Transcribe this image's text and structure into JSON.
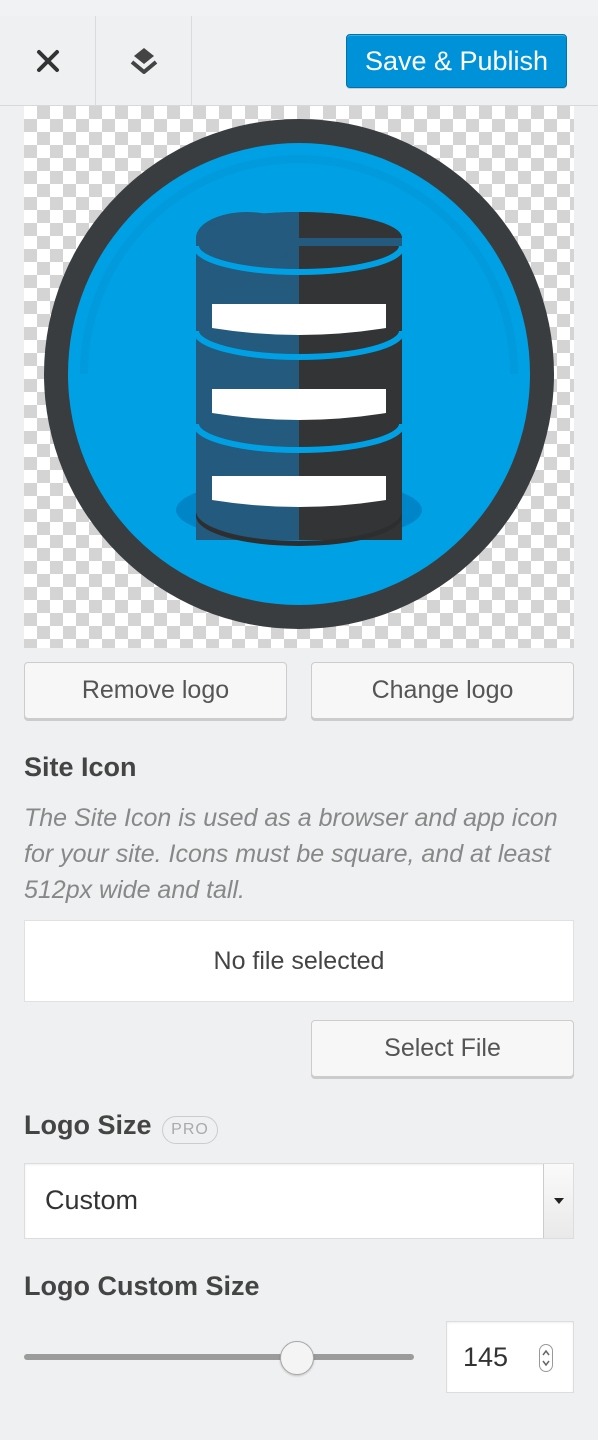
{
  "header": {
    "close_icon": "close-icon",
    "collapse_icon": "collapse-icon",
    "publish_label": "Save & Publish"
  },
  "logo": {
    "remove_label": "Remove logo",
    "change_label": "Change logo",
    "image_icon": "database-logo-icon"
  },
  "site_icon": {
    "title": "Site Icon",
    "description": "The Site Icon is used as a browser and app icon for your site. Icons must be square, and at least 512px wide and tall.",
    "file_status": "No file selected",
    "select_label": "Select File"
  },
  "logo_size": {
    "title": "Logo Size",
    "badge": "PRO",
    "selected": "Custom"
  },
  "logo_custom_size": {
    "title": "Logo Custom Size",
    "value": "145",
    "slider_fraction": 0.7
  },
  "colors": {
    "accent": "#0092d8",
    "logo_blue": "#00a0e4",
    "logo_dark": "#3a3d40"
  }
}
